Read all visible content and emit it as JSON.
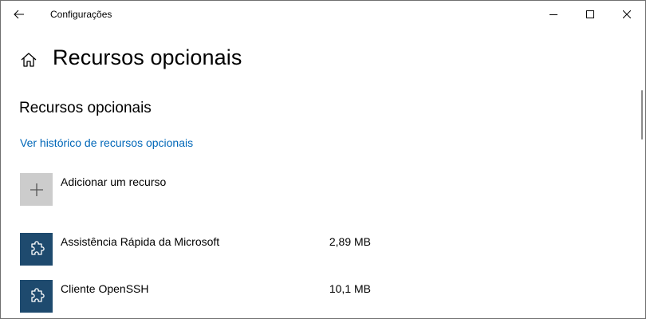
{
  "window": {
    "title": "Configurações"
  },
  "icons": {
    "back": "back-arrow-icon",
    "minimize": "minimize-icon",
    "maximize": "maximize-icon",
    "close": "close-icon",
    "home": "home-icon",
    "add": "plus-icon",
    "feature": "puzzle-piece-icon"
  },
  "header": {
    "title": "Recursos opcionais"
  },
  "section": {
    "title": "Recursos opcionais",
    "history_link": "Ver histórico de recursos opcionais",
    "add_feature_label": "Adicionar um recurso"
  },
  "features": [
    {
      "name": "Assistência Rápida da Microsoft",
      "size": "2,89 MB"
    },
    {
      "name": "Cliente OpenSSH",
      "size": "10,1 MB"
    }
  ],
  "colors": {
    "link": "#0067b8",
    "feature_tile": "#1e4a6e",
    "add_tile": "#cccccc"
  }
}
